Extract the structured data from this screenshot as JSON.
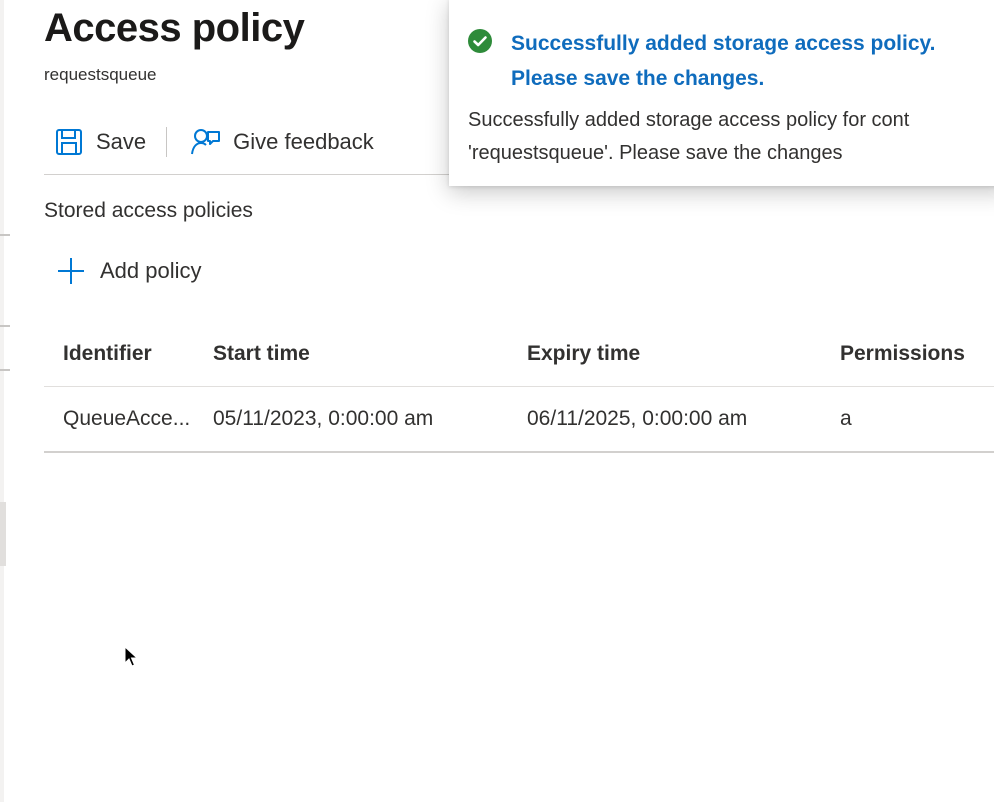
{
  "page": {
    "title": "Access policy",
    "subtitle": "requestsqueue"
  },
  "toolbar": {
    "save_label": "Save",
    "save_icon": "save-icon",
    "feedback_label": "Give feedback",
    "feedback_icon": "feedback-icon"
  },
  "section": {
    "label": "Stored access policies",
    "add_label": "Add policy",
    "add_icon": "plus-icon"
  },
  "table": {
    "columns": [
      "Identifier",
      "Start time",
      "Expiry time",
      "Permissions"
    ],
    "rows": [
      [
        "QueueAcce...",
        "05/11/2023, 0:00:00 am",
        "06/11/2025, 0:00:00 am",
        "a"
      ]
    ]
  },
  "notification": {
    "icon": "success-check-icon",
    "title_line1": "Successfully added storage access policy.",
    "title_line2": "Please save the changes.",
    "body_line1": "Successfully added storage access policy for cont",
    "body_line2": "'requestsqueue'. Please save the changes"
  },
  "colors": {
    "accent": "#0f6cbd",
    "success": "#2e8b3a",
    "icon_blue": "#0078d4",
    "text": "#323130"
  }
}
